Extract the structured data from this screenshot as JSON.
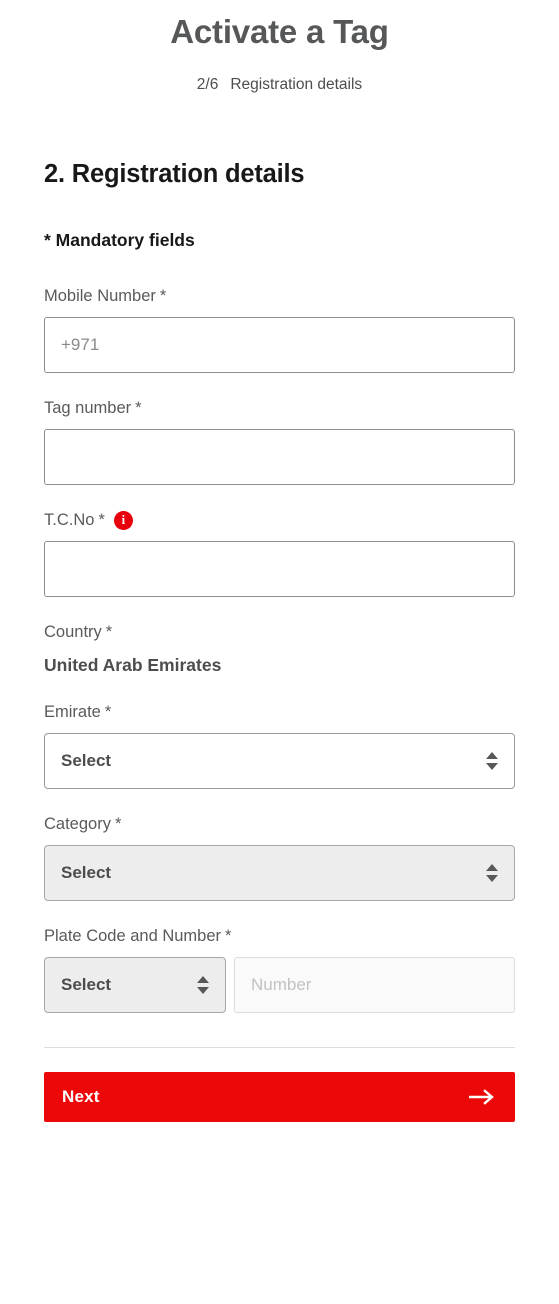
{
  "header": {
    "title": "Activate a Tag",
    "step_count": "2/6",
    "step_label": "Registration details"
  },
  "section": {
    "heading": "2. Registration details",
    "mandatory_note": "* Mandatory fields"
  },
  "form": {
    "mobile": {
      "label": "Mobile Number",
      "required_mark": "*",
      "value": "",
      "placeholder": "+971"
    },
    "tag_number": {
      "label": "Tag number",
      "required_mark": "*",
      "value": "",
      "placeholder": ""
    },
    "tc_no": {
      "label": "T.C.No",
      "required_mark": "*",
      "info_glyph": "i",
      "value": "",
      "placeholder": ""
    },
    "country": {
      "label": "Country",
      "required_mark": "*",
      "value": "United Arab Emirates"
    },
    "emirate": {
      "label": "Emirate",
      "required_mark": "*",
      "selected": "Select"
    },
    "category": {
      "label": "Category",
      "required_mark": "*",
      "selected": "Select"
    },
    "plate": {
      "label": "Plate Code and Number",
      "required_mark": "*",
      "code_selected": "Select",
      "number_value": "",
      "number_placeholder": "Number"
    }
  },
  "footer": {
    "next_label": "Next"
  },
  "colors": {
    "accent_red": "#ec0808",
    "info_red": "#e8000d",
    "title_grey": "#555759",
    "heading_black": "#17181a",
    "label_grey": "#5a5a5c",
    "disabled_fill": "#ededed"
  },
  "icons": {
    "info": "info-icon",
    "spinner": "select-spinner-icon",
    "arrow_right": "arrow-right-icon"
  }
}
